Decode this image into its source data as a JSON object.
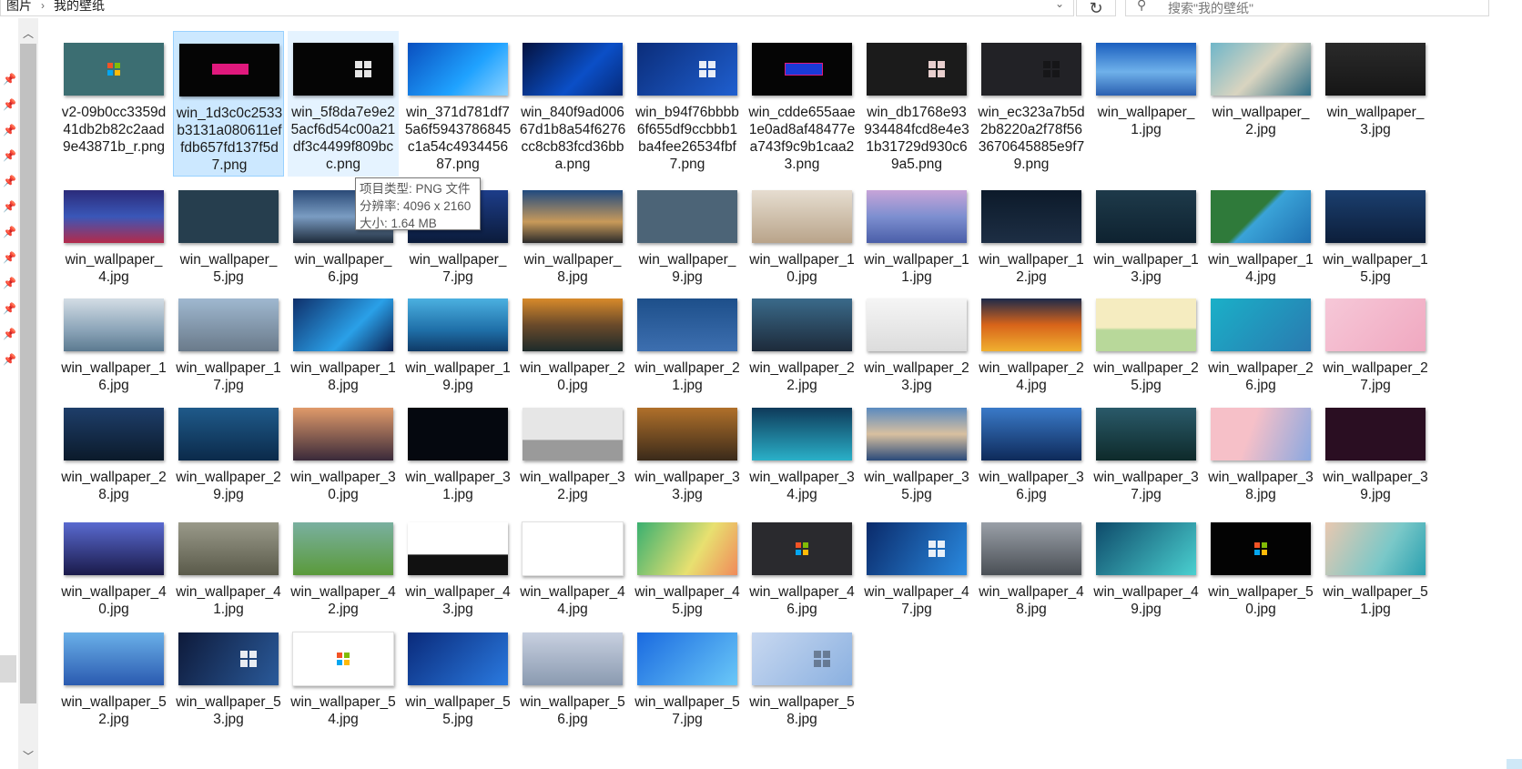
{
  "address": {
    "crumbs": [
      "图片",
      "我的壁纸"
    ],
    "dropdown_icon": "chevron-down-icon",
    "refresh_icon": "refresh-icon"
  },
  "search": {
    "placeholder": "搜索\"我的壁纸\"",
    "icon": "search-icon"
  },
  "tooltip": {
    "type_line": "项目类型: PNG 文件",
    "size_line": "分辨率: 4096 x 2160",
    "filesize_line": "大小: 1.64 MB"
  },
  "files": [
    {
      "name": "v2-09b0cc3359d41db2b82c2aad9e43871b_r.png",
      "bg": "#3c6e72",
      "logo": "color"
    },
    {
      "name": "win_1d3c0c2533b3131a080611effdb657fd137f5d7.png",
      "bg": "#050505",
      "logo": "hello",
      "state": "selected"
    },
    {
      "name": "win_5f8da7e9e25acf6d54c00a21df3c4499f809bcc.png",
      "bg": "#050505",
      "logo": "white-right",
      "state": "hover"
    },
    {
      "name": "win_371d781df75a6f5943786845c1a54c493445687.png",
      "bg": "linear-gradient(135deg,#0a4fbf,#1fa2ff 60%,#8fd3ff)"
    },
    {
      "name": "win_840f9ad00667d1b8a54f6276cc8cb83fcd36bba.png",
      "bg": "linear-gradient(135deg,#04123f,#0b4fc7 60%,#062a7a)"
    },
    {
      "name": "win_b94f76bbbb6f655df9ccbbb1ba4fee26534fbf7.png",
      "bg": "linear-gradient(135deg,#0b2d7a,#1f5fcf)",
      "logo": "white-right"
    },
    {
      "name": "win_cdde655aae1e0ad8af48477ea743f9c9b1caa23.png",
      "bg": "#050505",
      "logo": "hello-blue"
    },
    {
      "name": "win_db1768e93934484fcd8e4e31b31729d930c69a5.png",
      "bg": "#1b1b1b",
      "logo": "pink"
    },
    {
      "name": "win_ec323a7b5d2b8220a2f78f563670645885e9f79.png",
      "bg": "#222226",
      "logo": "dark"
    },
    {
      "name": "win_wallpaper_1.jpg",
      "bg": "linear-gradient(#1b5fbf,#6fb1ea 55%,#2a5fb0)"
    },
    {
      "name": "win_wallpaper_2.jpg",
      "bg": "linear-gradient(135deg,#6fb6c9,#d9d4c0,#2f6e86)"
    },
    {
      "name": "win_wallpaper_3.jpg",
      "bg": "linear-gradient(#2a2a2a,#161616)"
    },
    {
      "name": "win_wallpaper_4.jpg",
      "bg": "linear-gradient(#2b2b7a,#3a57b8 50%,#b42a4a)"
    },
    {
      "name": "win_wallpaper_5.jpg",
      "bg": "#263e4e"
    },
    {
      "name": "win_wallpaper_6.jpg",
      "bg": "linear-gradient(#2a4a77,#7a9cc2 50%,#1d2a3a)"
    },
    {
      "name": "win_wallpaper_7.jpg",
      "bg": "linear-gradient(#1d3d8a,#0b1b3a)"
    },
    {
      "name": "win_wallpaper_8.jpg",
      "bg": "linear-gradient(#1f4a80,#c89a5a 60%,#2a2a2a)"
    },
    {
      "name": "win_wallpaper_9.jpg",
      "bg": "#4c6477"
    },
    {
      "name": "win_wallpaper_10.jpg",
      "bg": "linear-gradient(#e6ddd0,#b9a48a)"
    },
    {
      "name": "win_wallpaper_11.jpg",
      "bg": "linear-gradient(#c7a4d8,#7d8fd0 50%,#4a5ea8)"
    },
    {
      "name": "win_wallpaper_12.jpg",
      "bg": "linear-gradient(#0c1a2a,#1d2e44)"
    },
    {
      "name": "win_wallpaper_13.jpg",
      "bg": "linear-gradient(#1e3a4a,#0e2230)"
    },
    {
      "name": "win_wallpaper_14.jpg",
      "bg": "linear-gradient(135deg,#2f7a3a 45%,#3aa3d8 50%,#1f6fb0)"
    },
    {
      "name": "win_wallpaper_15.jpg",
      "bg": "linear-gradient(#1b3f6f,#0c1e3a)"
    },
    {
      "name": "win_wallpaper_16.jpg",
      "bg": "linear-gradient(#d3dde5,#8ba4b8 60%,#5c7a90)"
    },
    {
      "name": "win_wallpaper_17.jpg",
      "bg": "linear-gradient(#9fb8d0,#6a7a8a)"
    },
    {
      "name": "win_wallpaper_18.jpg",
      "bg": "linear-gradient(135deg,#0f2f6a,#2aa0e8 60%,#0b2050)"
    },
    {
      "name": "win_wallpaper_19.jpg",
      "bg": "linear-gradient(#4bb0e0,#1f6fa8 60%,#0f3a66)"
    },
    {
      "name": "win_wallpaper_20.jpg",
      "bg": "linear-gradient(#d88a2a,#6a4a2a 50%,#1d2a2a)"
    },
    {
      "name": "win_wallpaper_21.jpg",
      "bg": "linear-gradient(#1d4f8a,#3d6fb0)"
    },
    {
      "name": "win_wallpaper_22.jpg",
      "bg": "linear-gradient(#3a6a8a,#1d2a3a)"
    },
    {
      "name": "win_wallpaper_23.jpg",
      "bg": "linear-gradient(#f5f5f5,#dcdcdc)"
    },
    {
      "name": "win_wallpaper_24.jpg",
      "bg": "linear-gradient(#1d2a4a,#d8641a 50%,#f0b030)"
    },
    {
      "name": "win_wallpaper_25.jpg",
      "bg": "linear-gradient(#f5ecc0 55%,#b8d89a 60%)"
    },
    {
      "name": "win_wallpaper_26.jpg",
      "bg": "linear-gradient(135deg,#1ab0c8,#2a7ab0)"
    },
    {
      "name": "win_wallpaper_27.jpg",
      "bg": "linear-gradient(135deg,#f6c8d8,#f0a8c0)"
    },
    {
      "name": "win_wallpaper_28.jpg",
      "bg": "linear-gradient(#1e3e6a,#0b1a2a)"
    },
    {
      "name": "win_wallpaper_29.jpg",
      "bg": "linear-gradient(#1f5a8a,#0b2a4a)"
    },
    {
      "name": "win_wallpaper_30.jpg",
      "bg": "linear-gradient(#e09a6a,#3a2a3a)"
    },
    {
      "name": "win_wallpaper_31.jpg",
      "bg": "#05080f"
    },
    {
      "name": "win_wallpaper_32.jpg",
      "bg": "linear-gradient(#e6e6e6 60%,#9a9a9a 62%)"
    },
    {
      "name": "win_wallpaper_33.jpg",
      "bg": "linear-gradient(#b0702a,#3a2a1a)"
    },
    {
      "name": "win_wallpaper_34.jpg",
      "bg": "linear-gradient(#0e3a5a,#2ab0c8)"
    },
    {
      "name": "win_wallpaper_35.jpg",
      "bg": "linear-gradient(#5a8ac0,#d8c0a0 50%,#2a4a7a)"
    },
    {
      "name": "win_wallpaper_36.jpg",
      "bg": "linear-gradient(#3a7ac8,#0e2a5a)"
    },
    {
      "name": "win_wallpaper_37.jpg",
      "bg": "linear-gradient(#2a5a6a,#0e2a2a)"
    },
    {
      "name": "win_wallpaper_38.jpg",
      "bg": "linear-gradient(110deg,#f6c0c8 40%,#8aa8e0)"
    },
    {
      "name": "win_wallpaper_39.jpg",
      "bg": "#2a0e22"
    },
    {
      "name": "win_wallpaper_40.jpg",
      "bg": "linear-gradient(#5a6ad0,#1a1a4a)"
    },
    {
      "name": "win_wallpaper_41.jpg",
      "bg": "linear-gradient(#9a9a8a,#5a5a4a)"
    },
    {
      "name": "win_wallpaper_42.jpg",
      "bg": "linear-gradient(#7ab0a0,#5a9a3a)"
    },
    {
      "name": "win_wallpaper_43.jpg",
      "bg": "linear-gradient(#ffffff 60%,#111 62%)"
    },
    {
      "name": "win_wallpaper_44.jpg",
      "bg": "#ffffff"
    },
    {
      "name": "win_wallpaper_45.jpg",
      "bg": "linear-gradient(120deg,#3ab070,#e8e070 60%,#f08a5a)"
    },
    {
      "name": "win_wallpaper_46.jpg",
      "bg": "#2a2a2e",
      "logo": "color"
    },
    {
      "name": "win_wallpaper_47.jpg",
      "bg": "linear-gradient(120deg,#0a2a6a,#2a8ae0)",
      "logo": "white-right"
    },
    {
      "name": "win_wallpaper_48.jpg",
      "bg": "linear-gradient(#9aa0a8,#4a4f55)"
    },
    {
      "name": "win_wallpaper_49.jpg",
      "bg": "linear-gradient(135deg,#0e4a6a,#4ad0d0)"
    },
    {
      "name": "win_wallpaper_50.jpg",
      "bg": "#030303",
      "logo": "color"
    },
    {
      "name": "win_wallpaper_51.jpg",
      "bg": "linear-gradient(120deg,#e8c8b0,#7ac8c8 60%,#2aa0b0)"
    },
    {
      "name": "win_wallpaper_52.jpg",
      "bg": "linear-gradient(#6ab0e8,#2a5ab0)"
    },
    {
      "name": "win_wallpaper_53.jpg",
      "bg": "linear-gradient(120deg,#0e1a3a,#2a5a9a)",
      "logo": "white-right"
    },
    {
      "name": "win_wallpaper_54.jpg",
      "bg": "#ffffff",
      "logo": "color"
    },
    {
      "name": "win_wallpaper_55.jpg",
      "bg": "linear-gradient(135deg,#0a2a7a,#2a7ae0)"
    },
    {
      "name": "win_wallpaper_56.jpg",
      "bg": "linear-gradient(#c8d0e0,#8a9ab0)"
    },
    {
      "name": "win_wallpaper_57.jpg",
      "bg": "linear-gradient(135deg,#1a6ae0,#6ac8f8)"
    },
    {
      "name": "win_wallpaper_58.jpg",
      "bg": "linear-gradient(135deg,#c8d8f0,#8ab0e0)",
      "logo": "dark"
    }
  ]
}
